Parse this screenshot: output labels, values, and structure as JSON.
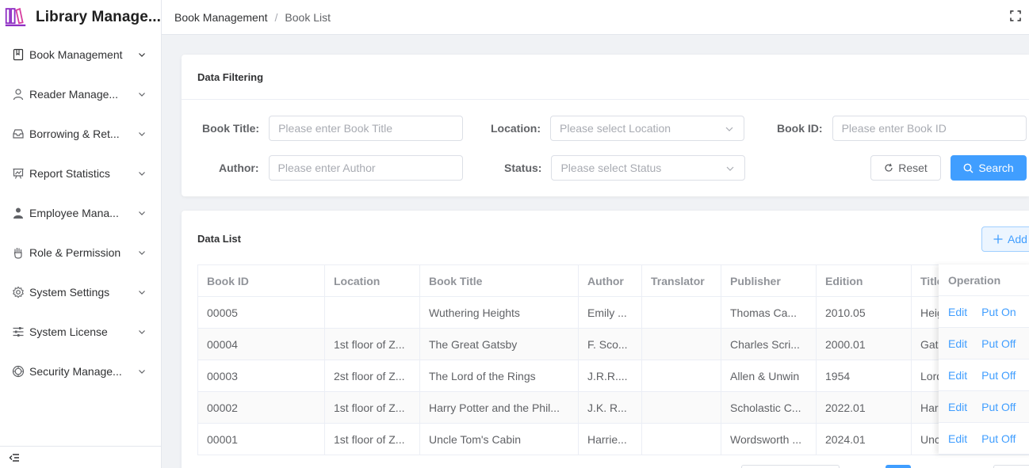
{
  "app": {
    "title": "Library Manage..."
  },
  "sidebar": {
    "items": [
      {
        "label": "Book Management",
        "icon": "book-icon"
      },
      {
        "label": "Reader Manage...",
        "icon": "user-icon"
      },
      {
        "label": "Borrowing & Ret...",
        "icon": "inbox-icon"
      },
      {
        "label": "Report Statistics",
        "icon": "chart-icon"
      },
      {
        "label": "Employee Mana...",
        "icon": "person-icon"
      },
      {
        "label": "Role & Permission",
        "icon": "hand-icon"
      },
      {
        "label": "System Settings",
        "icon": "gear-icon"
      },
      {
        "label": "System License",
        "icon": "sliders-icon"
      },
      {
        "label": "Security Manage...",
        "icon": "shield-icon"
      }
    ]
  },
  "header": {
    "breadcrumb": [
      "Book Management",
      "Book List"
    ]
  },
  "filter": {
    "title": "Data Filtering",
    "book_title_label": "Book Title:",
    "book_title_placeholder": "Please enter Book Title",
    "location_label": "Location:",
    "location_placeholder": "Please select Location",
    "book_id_label": "Book ID:",
    "book_id_placeholder": "Please enter Book ID",
    "author_label": "Author:",
    "author_placeholder": "Please enter Author",
    "status_label": "Status:",
    "status_placeholder": "Please select Status",
    "reset_label": "Reset",
    "search_label": "Search"
  },
  "list": {
    "title": "Data List",
    "add_label": "Add",
    "columns": [
      "Book ID",
      "Location",
      "Book Title",
      "Author",
      "Translator",
      "Publisher",
      "Edition",
      "Title"
    ],
    "operation_header": "Operation",
    "edit_label": "Edit",
    "rows": [
      {
        "cells": [
          "00005",
          "",
          "Wuthering Heights",
          "Emily ...",
          "",
          "Thomas Ca...",
          "2010.05",
          "Heig"
        ],
        "status_action": "Put On"
      },
      {
        "cells": [
          "00004",
          "1st floor of Z...",
          "The Great Gatsby",
          "F. Sco...",
          "",
          "Charles Scri...",
          "2000.01",
          "Gats"
        ],
        "status_action": "Put Off"
      },
      {
        "cells": [
          "00003",
          "2st floor of Z...",
          "The Lord of the Rings",
          "J.R.R....",
          "",
          "Allen & Unwin",
          "1954",
          "Lord"
        ],
        "status_action": "Put Off"
      },
      {
        "cells": [
          "00002",
          "1st floor of Z...",
          "Harry Potter and the Phil...",
          "J.K. R...",
          "",
          "Scholastic C...",
          "2022.01",
          "Harr"
        ],
        "status_action": "Put Off"
      },
      {
        "cells": [
          "00001",
          "1st floor of Z...",
          "Uncle Tom's Cabin",
          "Harrie...",
          "",
          "Wordsworth ...",
          "2024.01",
          "Unc"
        ],
        "status_action": "Put Off"
      }
    ]
  },
  "colors": {
    "primary": "#409eff",
    "brand_icon": "#8e2ec4"
  }
}
